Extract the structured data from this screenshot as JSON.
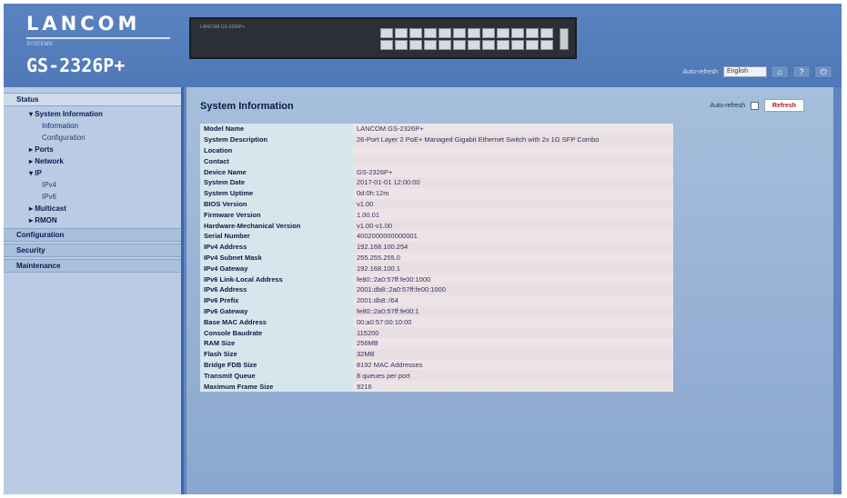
{
  "header": {
    "brand": "LANCOM",
    "brand_sub": "SYSTEMS",
    "model": "GS-2326P+",
    "device_label": "LANCOM GS-2326P+",
    "toolbar_label": "Auto-refresh",
    "toolbar_select": "English"
  },
  "sidebar": {
    "items": [
      {
        "label": "Status",
        "level": 0,
        "active": true
      },
      {
        "label": "▾ System Information",
        "level": 1
      },
      {
        "label": "Information",
        "level": 2,
        "selected": true
      },
      {
        "label": "Configuration",
        "level": 2
      },
      {
        "label": "▸ Ports",
        "level": 1
      },
      {
        "label": "▸ Network",
        "level": 1
      },
      {
        "label": "▾ IP",
        "level": 1
      },
      {
        "label": "IPv4",
        "level": 2
      },
      {
        "label": "IPv6",
        "level": 2
      },
      {
        "label": "▸ Multicast",
        "level": 1
      },
      {
        "label": "▸ RMON",
        "level": 1
      },
      {
        "label": "Configuration",
        "level": 0
      },
      {
        "label": "Security",
        "level": 0
      },
      {
        "label": "Maintenance",
        "level": 0
      }
    ]
  },
  "main": {
    "title": "System Information",
    "refresh_label": "Auto-refresh",
    "refresh_button": "Refresh",
    "rows": [
      {
        "key": "Model Name",
        "value": "LANCOM GS-2326P+"
      },
      {
        "key": "System Description",
        "value": "26-Port Layer 2 PoE+ Managed Gigabit Ethernet Switch with 2x 1G SFP Combo"
      },
      {
        "key": "Location",
        "value": ""
      },
      {
        "key": "Contact",
        "value": ""
      },
      {
        "key": "Device Name",
        "value": "GS-2326P+"
      },
      {
        "key": "System Date",
        "value": "2017-01-01 12:00:00"
      },
      {
        "key": "System Uptime",
        "value": "0d:0h:12m"
      },
      {
        "key": "BIOS Version",
        "value": "v1.00"
      },
      {
        "key": "Firmware Version",
        "value": "1.00.01"
      },
      {
        "key": "Hardware-Mechanical Version",
        "value": "v1.00-v1.00"
      },
      {
        "key": "Serial Number",
        "value": "4002000000000001"
      },
      {
        "key": "IPv4 Address",
        "value": "192.168.100.254"
      },
      {
        "key": "IPv4 Subnet Mask",
        "value": "255.255.255.0"
      },
      {
        "key": "IPv4 Gateway",
        "value": "192.168.100.1"
      },
      {
        "key": "IPv6 Link-Local Address",
        "value": "fe80::2a0:57ff:fe00:1000"
      },
      {
        "key": "IPv6 Address",
        "value": "2001:db8::2a0:57ff:fe00:1000"
      },
      {
        "key": "IPv6 Prefix",
        "value": "2001:db8::/64"
      },
      {
        "key": "IPv6 Gateway",
        "value": "fe80::2a0:57ff:fe00:1"
      },
      {
        "key": "Base MAC Address",
        "value": "00:a0:57:00:10:00"
      },
      {
        "key": "Console Baudrate",
        "value": "115200"
      },
      {
        "key": "RAM Size",
        "value": "256MB"
      },
      {
        "key": "Flash Size",
        "value": "32MB"
      },
      {
        "key": "Bridge FDB Size",
        "value": "8192 MAC Addresses"
      },
      {
        "key": "Transmit Queue",
        "value": "8 queues per port"
      },
      {
        "key": "Maximum Frame Size",
        "value": "9216"
      }
    ]
  }
}
